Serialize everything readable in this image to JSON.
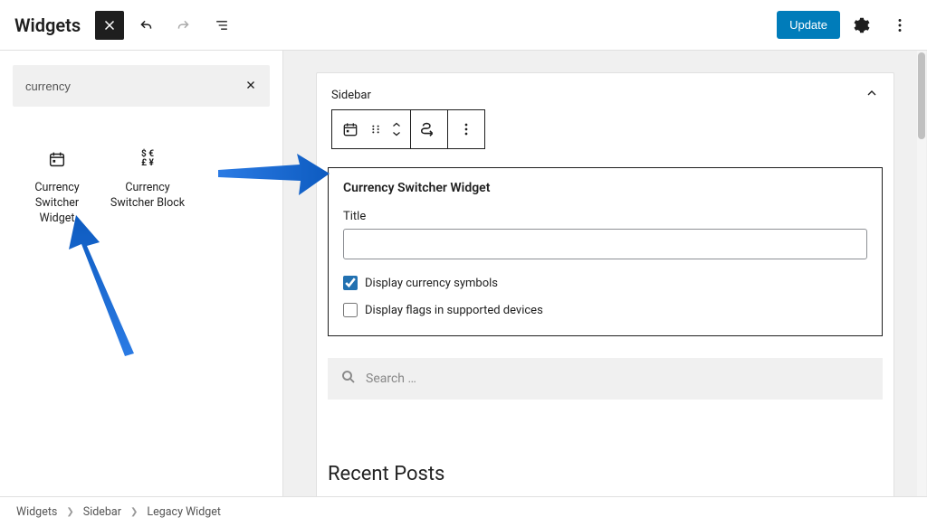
{
  "header": {
    "title": "Widgets",
    "update_label": "Update"
  },
  "search": {
    "value": "currency"
  },
  "blocks": [
    {
      "label": "Currency Switcher Widget",
      "icon": "calendar"
    },
    {
      "label": "Currency Switcher Block",
      "icon": "multicurrency"
    }
  ],
  "sidebar": {
    "label": "Sidebar"
  },
  "widget_form": {
    "heading": "Currency Switcher Widget",
    "title_label": "Title",
    "title_value": "",
    "display_symbols_label": "Display currency symbols",
    "display_symbols_checked": true,
    "display_flags_label": "Display flags in supported devices",
    "display_flags_checked": false
  },
  "search_widget": {
    "placeholder": "Search …"
  },
  "recent_posts": {
    "heading": "Recent Posts"
  },
  "breadcrumb": {
    "items": [
      "Widgets",
      "Sidebar",
      "Legacy Widget"
    ]
  }
}
